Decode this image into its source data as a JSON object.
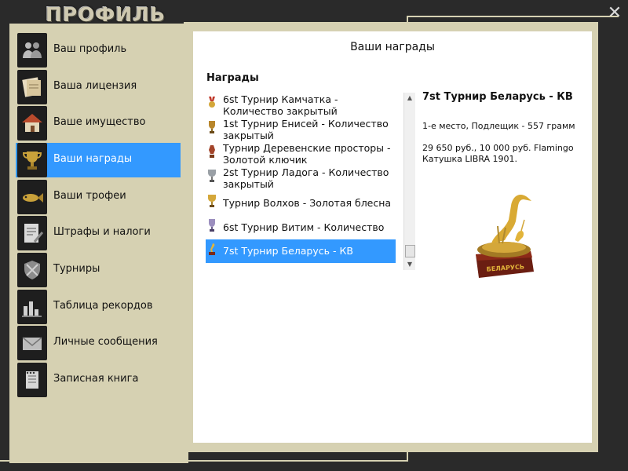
{
  "window": {
    "title": "ПРОФИЛЬ",
    "close_glyph": "✕"
  },
  "sidebar": {
    "items": [
      {
        "label": "Ваш профиль",
        "icon": "people-icon",
        "active": false
      },
      {
        "label": "Ваша лицензия",
        "icon": "license-icon",
        "active": false
      },
      {
        "label": "Ваше имущество",
        "icon": "house-icon",
        "active": false
      },
      {
        "label": "Ваши награды",
        "icon": "trophy-icon",
        "active": true
      },
      {
        "label": "Ваши трофеи",
        "icon": "fish-icon",
        "active": false
      },
      {
        "label": "Штрафы и налоги",
        "icon": "fine-document-icon",
        "active": false
      },
      {
        "label": "Турниры",
        "icon": "tournament-shield-icon",
        "active": false
      },
      {
        "label": "Таблица рекордов",
        "icon": "bar-chart-icon",
        "active": false
      },
      {
        "label": "Личные сообщения",
        "icon": "envelope-icon",
        "active": false
      },
      {
        "label": "Записная книга",
        "icon": "notebook-icon",
        "active": false
      }
    ],
    "accent_color": "#3399ff"
  },
  "main": {
    "title": "Ваши награды",
    "awards_heading": "Награды",
    "awards": [
      {
        "lines": [
          "6st Турнир Камчатка -",
          "Количество закрытый"
        ],
        "icon": "medal-icon",
        "selected": false
      },
      {
        "lines": [
          "1st Турнир Енисей - Количество",
          "закрытый"
        ],
        "icon": "cup-icon",
        "selected": false
      },
      {
        "lines": [
          "Турнир Деревенские просторы -",
          "Золотой ключик"
        ],
        "icon": "vase-trophy-icon",
        "selected": false
      },
      {
        "lines": [
          "2st Турнир Ладога - Количество",
          "закрытый"
        ],
        "icon": "silver-cup-icon",
        "selected": false
      },
      {
        "lines": [
          "Турнир Волхов - Золотая блесна"
        ],
        "icon": "gold-cup-icon",
        "selected": false
      },
      {
        "lines": [
          "6st Турнир Витим - Количество"
        ],
        "icon": "cup-icon",
        "selected": false
      },
      {
        "lines": [
          "7st Турнир Беларусь - КВ"
        ],
        "icon": "stork-trophy-icon",
        "selected": true
      }
    ],
    "detail": {
      "title": "7st Турнир Беларусь - КВ",
      "place": "1-е место, Подлещик - 557 грамм",
      "prize": "29 650 руб., 10 000 руб. Flamingo Катушка LIBRA 1901.",
      "image_label": "БЕЛАРУСЬ"
    }
  }
}
